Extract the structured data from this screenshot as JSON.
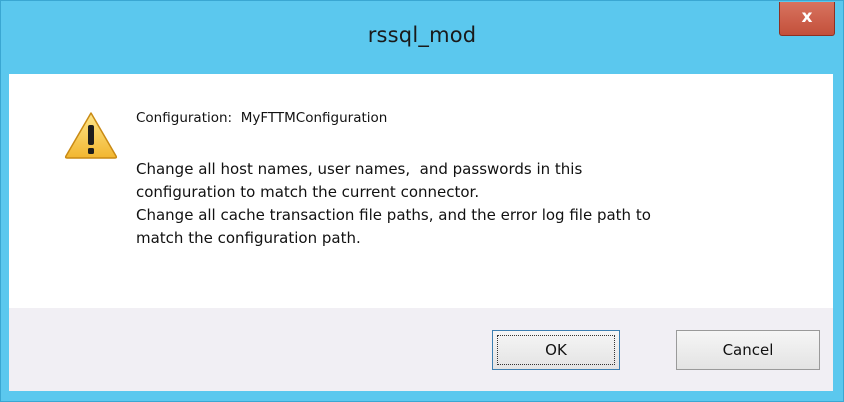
{
  "window": {
    "title": "rssql_mod",
    "close_label": "x"
  },
  "content": {
    "icon": "warning-icon",
    "config_label": "Configuration:",
    "config_name": "MyFTTMConfiguration",
    "message_lines": [
      "Change all host names, user names,  and passwords in this",
      "configuration to match the current connector.",
      "Change all cache transaction file paths, and the error log file path to",
      "match the configuration path."
    ]
  },
  "buttons": {
    "ok_label": "OK",
    "cancel_label": "Cancel"
  },
  "colors": {
    "titlebar": "#5bc8ee",
    "close": "#c75a45",
    "footer": "#f1eff4"
  }
}
